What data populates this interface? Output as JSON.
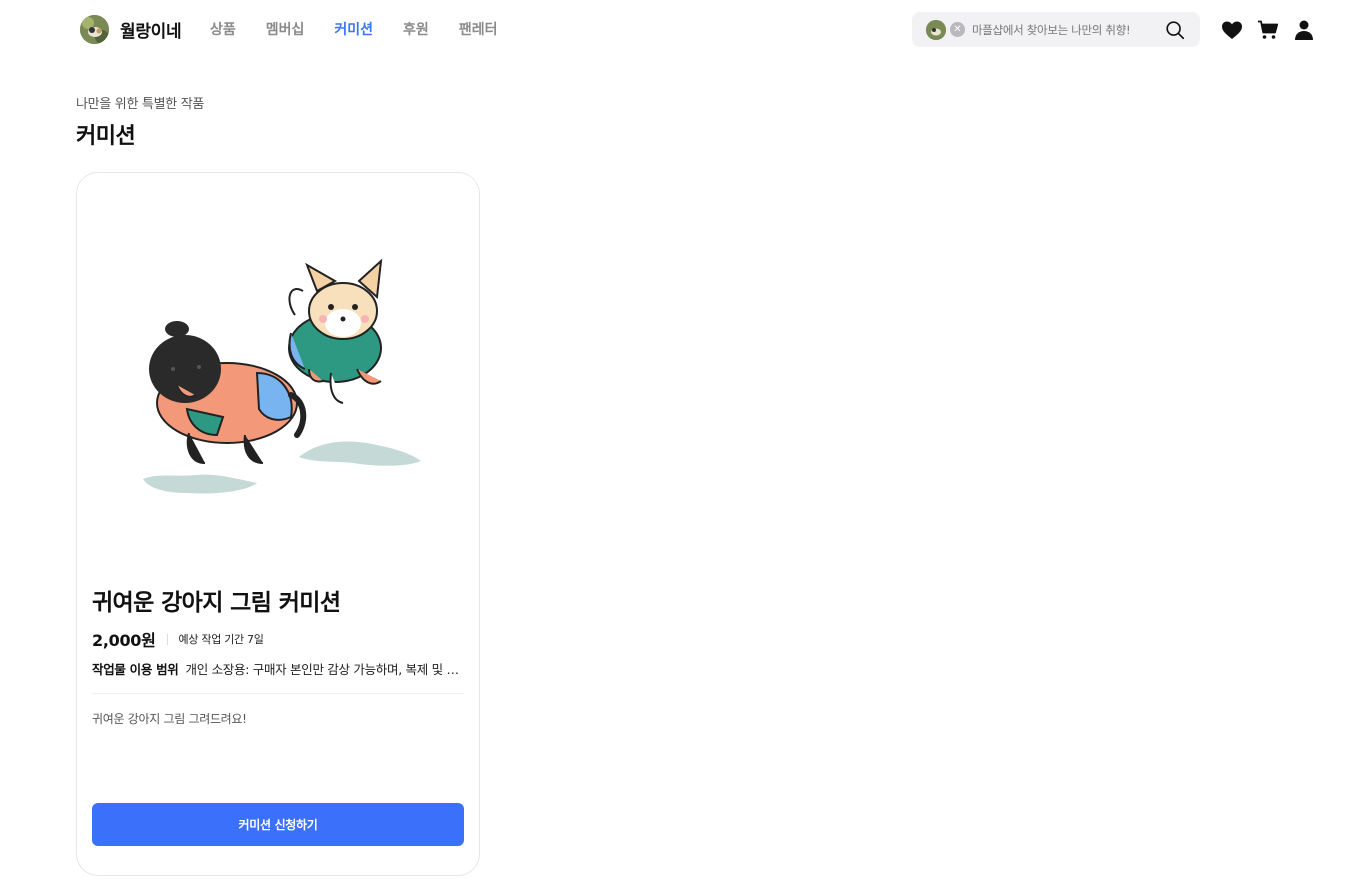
{
  "header": {
    "brand_name": "월랑이네",
    "nav": [
      {
        "label": "상품",
        "active": false
      },
      {
        "label": "멤버십",
        "active": false
      },
      {
        "label": "커미션",
        "active": true
      },
      {
        "label": "후원",
        "active": false
      },
      {
        "label": "팬레터",
        "active": false
      }
    ],
    "search": {
      "placeholder": "마플샵에서 찾아보는 나만의 취향!",
      "clear_icon": "close-circle-icon",
      "search_icon": "search-icon"
    },
    "icons": [
      "heart-icon",
      "cart-icon",
      "user-icon"
    ]
  },
  "page": {
    "subtitle": "나만을 위한 특별한 작품",
    "title": "커미션"
  },
  "card": {
    "image": "cute-dogs-illustration",
    "title": "귀여운 강아지 그림 커미션",
    "price": "2,000원",
    "period": "예상 작업 기간 7일",
    "usage_label": "작업물 이용 범위",
    "usage_value": "개인 소장용: 구매자 본인만 감상 가능하며, 복제 및 배포는 불가합니다.",
    "description": "귀여운 강아지 그림 그려드려요!",
    "cta_label": "커미션 신청하기"
  },
  "colors": {
    "accent": "#3a74f7",
    "button": "#3a70fa",
    "nav_inactive": "#8b8b8b",
    "search_bg": "#f2f2f4"
  }
}
